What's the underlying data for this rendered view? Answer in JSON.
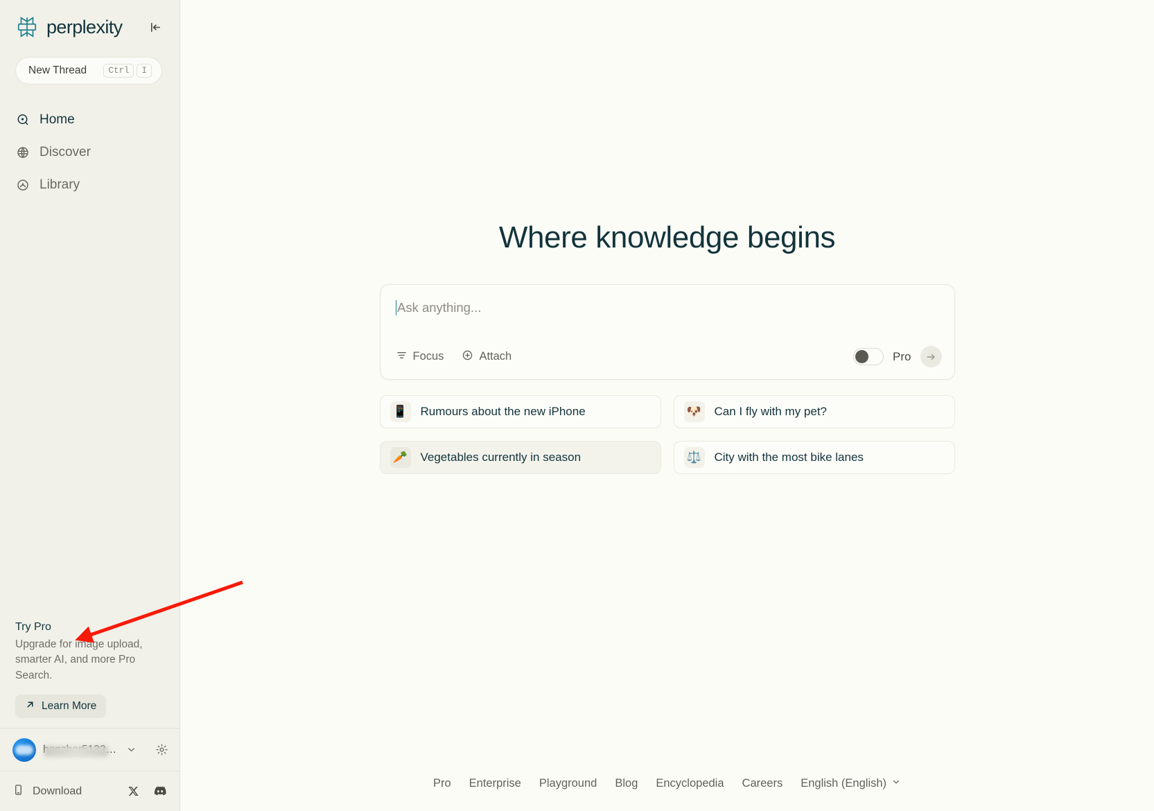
{
  "sidebar": {
    "brand": "perplexity",
    "collapse_icon": "collapse-sidebar-icon",
    "new_thread": {
      "label": "New Thread",
      "keys": [
        "Ctrl",
        "I"
      ]
    },
    "nav": [
      {
        "label": "Home",
        "icon": "home-target-icon",
        "active": true
      },
      {
        "label": "Discover",
        "icon": "discover-globe-icon",
        "active": false
      },
      {
        "label": "Library",
        "icon": "library-icon",
        "active": false
      }
    ],
    "try_pro": {
      "title": "Try Pro",
      "description": "Upgrade for image upload, smarter AI, and more Pro Search.",
      "button": "Learn More",
      "button_icon": "arrow-up-right-icon"
    },
    "user": {
      "name": "hanzhor5132…",
      "chevron": "chevron-down-icon",
      "settings_icon": "gear-icon"
    },
    "download": {
      "label": "Download",
      "icon": "phone-icon"
    },
    "social": [
      {
        "name": "x-twitter-icon"
      },
      {
        "name": "discord-icon"
      }
    ]
  },
  "main": {
    "hero_title": "Where knowledge begins",
    "ask": {
      "placeholder": "Ask anything...",
      "value": "",
      "focus_label": "Focus",
      "attach_label": "Attach",
      "pro_label": "Pro",
      "pro_enabled": false,
      "send_icon": "arrow-right-icon"
    },
    "suggestions": [
      {
        "emoji": "📱",
        "text": "Rumours about the new iPhone",
        "hover": false
      },
      {
        "emoji": "🐶",
        "text": "Can I fly with my pet?",
        "hover": false
      },
      {
        "emoji": "🥕",
        "text": "Vegetables currently in season",
        "hover": true
      },
      {
        "emoji": "⚖️",
        "text": "City with the most bike lanes",
        "hover": false
      }
    ],
    "footer": {
      "links": [
        "Pro",
        "Enterprise",
        "Playground",
        "Blog",
        "Encyclopedia",
        "Careers"
      ],
      "language": "English (English)",
      "language_chevron": "chevron-down-icon"
    }
  },
  "annotation": {
    "color": "#f91a07",
    "target": "Learn More"
  },
  "colors": {
    "accent": "#20808d",
    "brand_dark": "#13343b",
    "sidebar_bg": "#f1f1ea",
    "main_bg": "#fcfcf7"
  }
}
